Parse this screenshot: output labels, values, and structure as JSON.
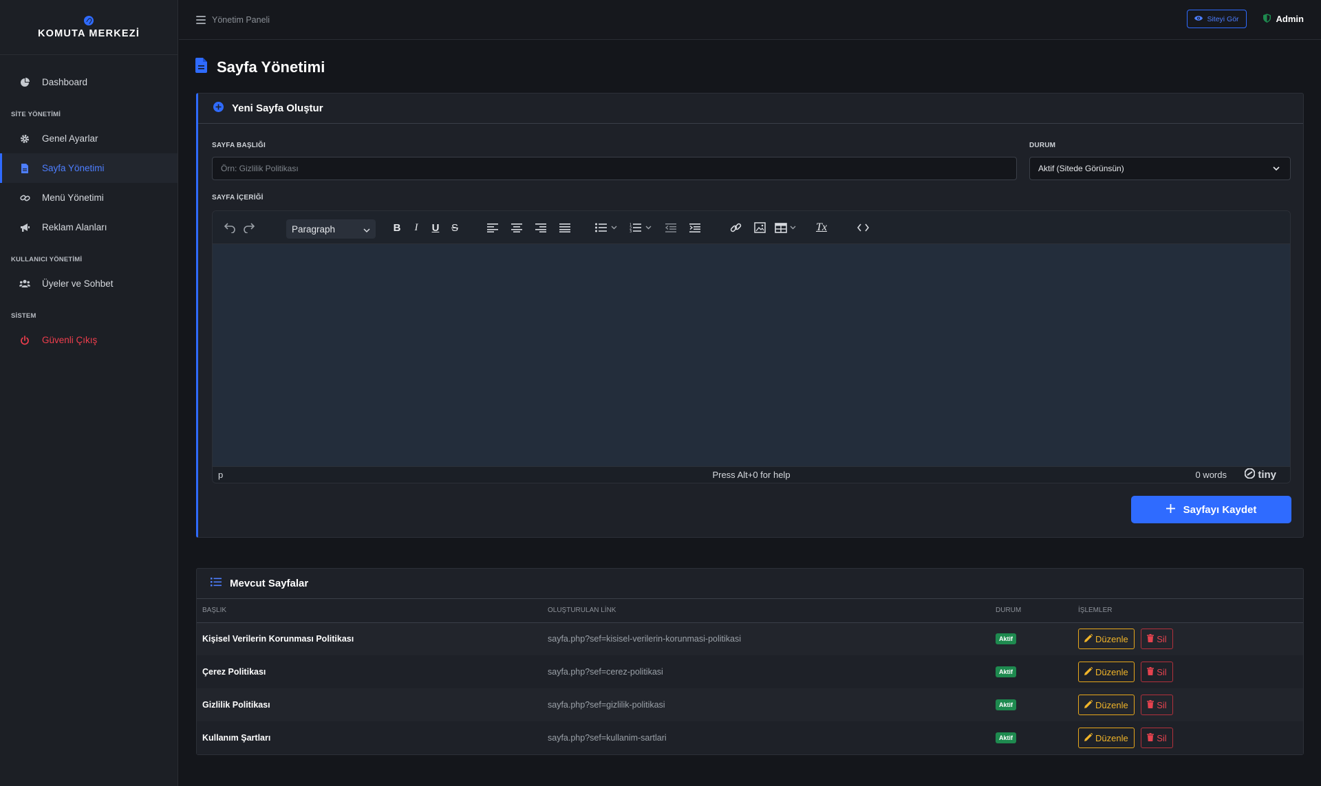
{
  "brand": {
    "title": "KOMUTA MERKEZİ"
  },
  "sidebar": {
    "dashboard": "Dashboard",
    "section_site": "SİTE YÖNETİMİ",
    "general": "Genel Ayarlar",
    "pages": "Sayfa Yönetimi",
    "menu": "Menü Yönetimi",
    "ads": "Reklam Alanları",
    "section_users": "KULLANICI YÖNETİMİ",
    "members": "Üyeler ve Sohbet",
    "section_system": "SİSTEM",
    "logout": "Güvenli Çıkış"
  },
  "topbar": {
    "breadcrumb": "Yönetim Paneli",
    "view_site": "Siteyi Gör",
    "user": "Admin"
  },
  "page": {
    "title": "Sayfa Yönetimi"
  },
  "form": {
    "heading": "Yeni Sayfa Oluştur",
    "title_label": "SAYFA BAŞLIĞI",
    "title_placeholder": "Örn: Gizlilik Politikası",
    "status_label": "DURUM",
    "status_value": "Aktif (Sitede Görünsün)",
    "content_label": "SAYFA İÇERİĞİ",
    "save": "Sayfayı Kaydet"
  },
  "editor": {
    "format": "Paragraph",
    "bold": "B",
    "italic": "I",
    "underline": "U",
    "strike": "S",
    "clear": "Tx",
    "status_path": "p",
    "help": "Press Alt+0 for help",
    "words": "0 words",
    "brand": "tiny"
  },
  "list": {
    "heading": "Mevcut Sayfalar",
    "columns": [
      "BAŞLIK",
      "OLUŞTURULAN LİNK",
      "DURUM",
      "İŞLEMLER"
    ],
    "edit_label": "Düzenle",
    "delete_label": "Sil",
    "rows": [
      {
        "title": "Kişisel Verilerin Korunması Politikası",
        "link": "sayfa.php?sef=kisisel-verilerin-korunmasi-politikasi",
        "status": "Aktif"
      },
      {
        "title": "Çerez Politikası",
        "link": "sayfa.php?sef=cerez-politikasi",
        "status": "Aktif"
      },
      {
        "title": "Gizlilik Politikası",
        "link": "sayfa.php?sef=gizlilik-politikasi",
        "status": "Aktif"
      },
      {
        "title": "Kullanım Şartları",
        "link": "sayfa.php?sef=kullanim-sartlari",
        "status": "Aktif"
      }
    ]
  },
  "colors": {
    "accent": "#2f6bff",
    "success": "#1e8a4f",
    "warning": "#f0b429",
    "danger": "#e5434f"
  }
}
